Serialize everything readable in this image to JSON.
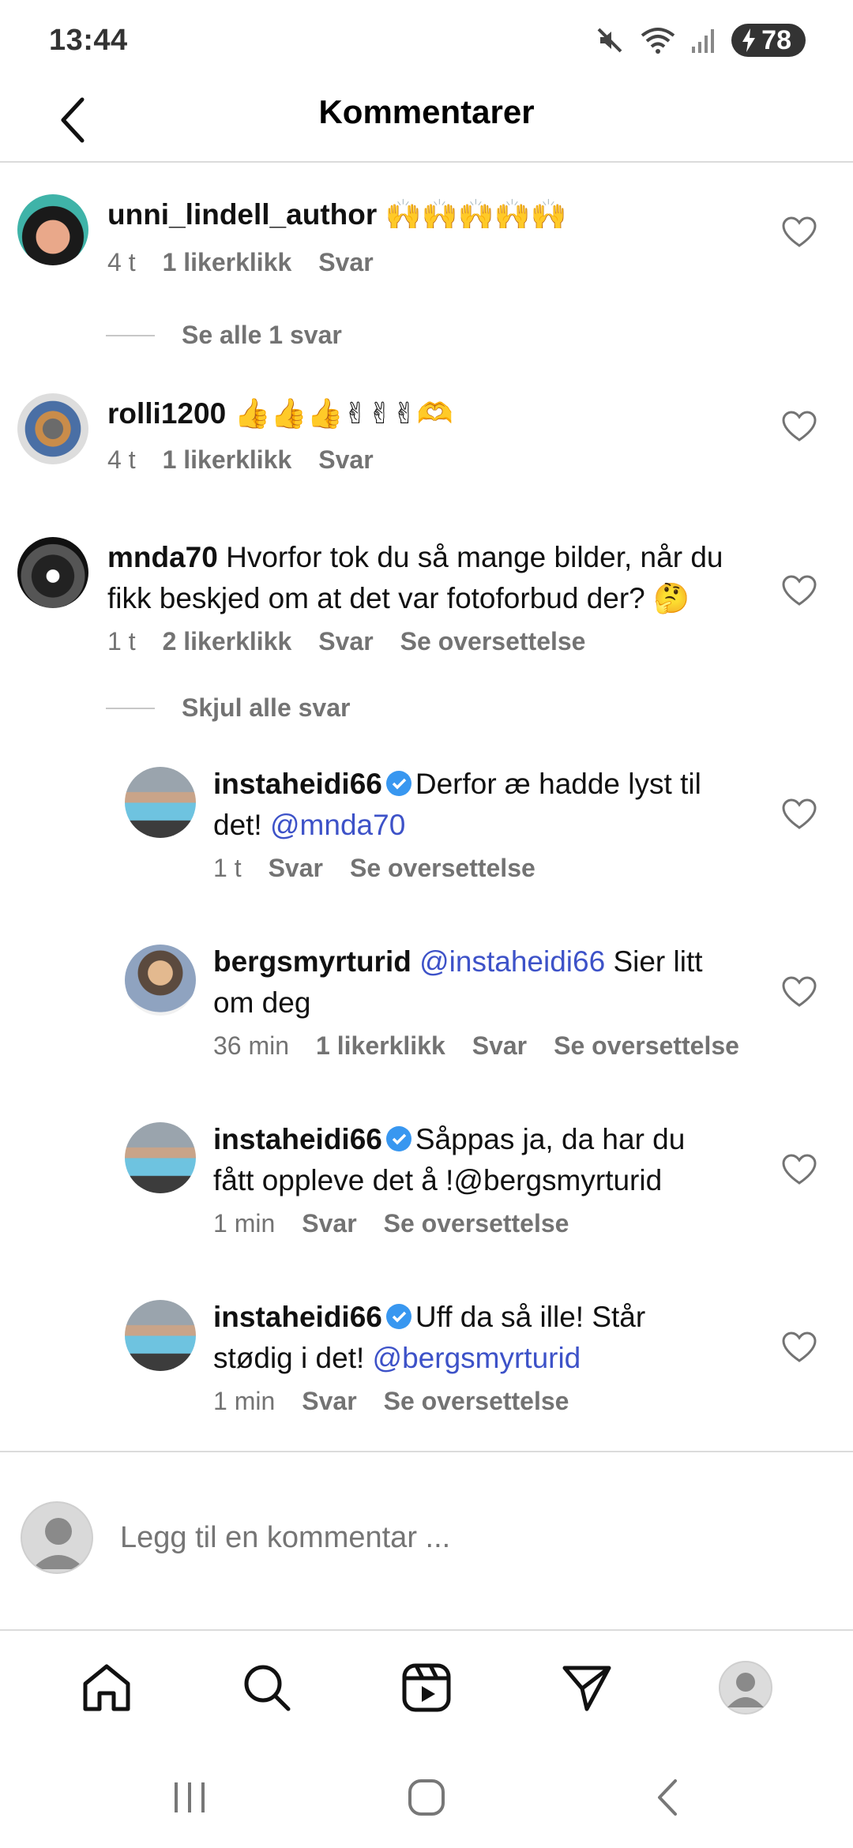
{
  "status_bar": {
    "time": "13:44",
    "battery": "78"
  },
  "header": {
    "title": "Kommentarer"
  },
  "comments": [
    {
      "username": "unni_lindell_author",
      "text": "🙌🙌🙌🙌🙌",
      "time": "4 t",
      "likes": "1 likerklikk",
      "reply": "Svar",
      "view_replies": "Se alle 1 svar"
    },
    {
      "username": "rolli1200",
      "text": "👍👍👍✌✌✌🫶",
      "time": "4 t",
      "likes": "1 likerklikk",
      "reply": "Svar"
    },
    {
      "username": "mnda70",
      "text": "Hvorfor tok du så mange bilder, når du",
      "text2": "fikk beskjed om at det var fotoforbud der? 🤔",
      "time": "1 t",
      "likes": "2 likerklikk",
      "reply": "Svar",
      "translate": "Se oversettelse",
      "hide_replies": "Skjul alle svar"
    }
  ],
  "replies": [
    {
      "username": "instaheidi66",
      "verified": true,
      "text": "Derfor æ hadde lyst til",
      "text2_prefix": "det! ",
      "mention": "@mnda70",
      "time": "1 t",
      "reply": "Svar",
      "translate": "Se oversettelse"
    },
    {
      "username": "bergsmyrturid",
      "mention": "@instaheidi66",
      "text": "Sier litt",
      "text2": "om deg",
      "time": "36 min",
      "likes": "1 likerklikk",
      "reply": "Svar",
      "translate": "Se oversettelse"
    },
    {
      "username": "instaheidi66",
      "verified": true,
      "text": "Såppas ja, da har du",
      "text2": "fått oppleve det å !@bergsmyrturid",
      "time": "1 min",
      "reply": "Svar",
      "translate": "Se oversettelse"
    },
    {
      "username": "instaheidi66",
      "verified": true,
      "text": "Uff da så ille! Står",
      "text2_prefix": "stødig i det! ",
      "mention": "@bergsmyrturid",
      "time": "1 min",
      "reply": "Svar",
      "translate": "Se oversettelse"
    }
  ],
  "input": {
    "placeholder": "Legg til en kommentar ..."
  },
  "nav": [
    "home-icon",
    "search-icon",
    "reels-icon",
    "direct-icon",
    "profile-icon"
  ],
  "colors": {
    "mention": "#3d52c8",
    "verified": "#3897f0",
    "secondary_text": "#737373"
  }
}
